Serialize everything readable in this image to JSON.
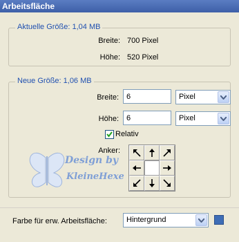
{
  "window": {
    "title": "Arbeitsfläche"
  },
  "current_size": {
    "legend": "Aktuelle Größe: 1,04 MB",
    "width_label": "Breite:",
    "width_value": "700 Pixel",
    "height_label": "Höhe:",
    "height_value": "520 Pixel"
  },
  "new_size": {
    "legend": "Neue Größe: 1,06 MB",
    "width_label": "Breite:",
    "width_value": "6",
    "width_unit": "Pixel",
    "height_label": "Höhe:",
    "height_value": "6",
    "height_unit": "Pixel",
    "relative_label": "Relativ",
    "relative_checked": true,
    "anchor_label": "Anker:"
  },
  "extension": {
    "label": "Farbe für erw. Arbeitsfläche:",
    "value": "Hintergrund",
    "color": "#3E6DB6"
  },
  "watermark": {
    "line1": "Design by",
    "line2": "KleineHexe"
  },
  "icons": [
    "arrow-nw-icon",
    "arrow-n-icon",
    "arrow-ne-icon",
    "arrow-w-icon",
    "arrow-e-icon",
    "arrow-sw-icon",
    "arrow-s-icon",
    "arrow-se-icon",
    "chevron-down-icon",
    "checkmark-icon"
  ]
}
